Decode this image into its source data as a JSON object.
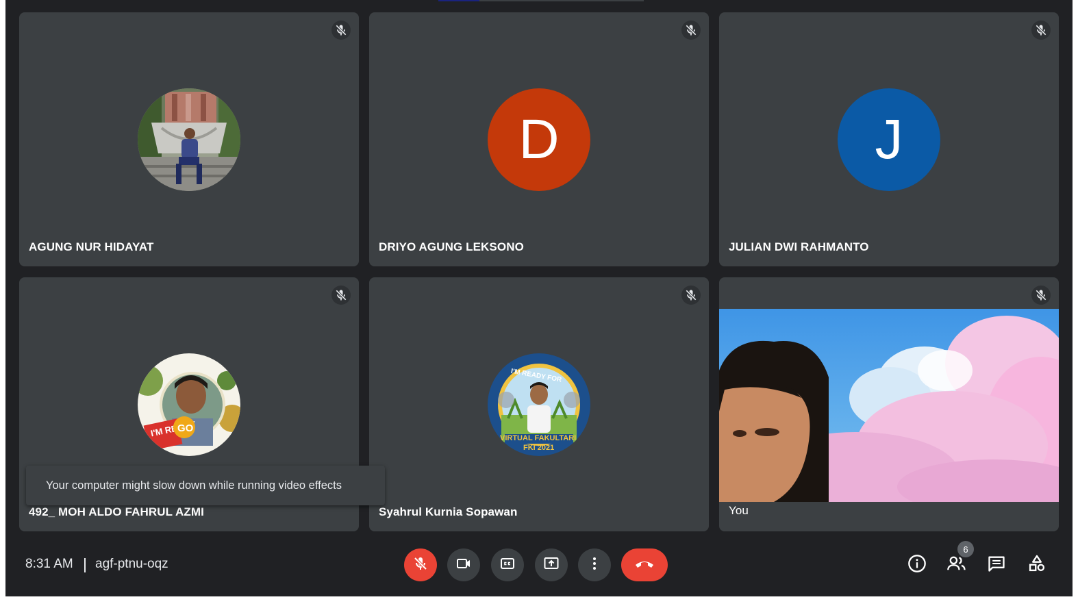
{
  "meeting": {
    "time": "8:31 AM",
    "code": "agf-ptnu-oqz"
  },
  "participants": [
    {
      "name": "AGUNG NUR HIDAYAT",
      "avatar_type": "photo",
      "muted": true
    },
    {
      "name": "DRIYO AGUNG LEKSONO",
      "avatar_type": "letter",
      "letter": "D",
      "color": "#c4390a",
      "muted": true
    },
    {
      "name": "JULIAN DWI RAHMANTO",
      "avatar_type": "letter",
      "letter": "J",
      "color": "#0b5aa6",
      "muted": true
    },
    {
      "name": "492_ MOH ALDO FAHRUL AZMI",
      "avatar_type": "photo",
      "muted": true
    },
    {
      "name": "Syahrul Kurnia Sopawan",
      "avatar_type": "photo",
      "muted": true
    },
    {
      "name": "You",
      "avatar_type": "video",
      "muted": true
    }
  ],
  "avatar_texts": {
    "aldo_badge_left": "I'M READY",
    "aldo_badge_right": "GO",
    "syahrul_top": "I'M READY FOR",
    "syahrul_bottom1": "VIRTUAL FAKULTARI",
    "syahrul_bottom2": "FKI 2021"
  },
  "toast": {
    "message": "Your computer might slow down while running video effects"
  },
  "controls": {
    "mic": "mic-off-icon",
    "camera": "video-camera-icon",
    "captions": "closed-captions-icon",
    "present": "present-screen-icon",
    "more": "more-options-icon",
    "leave": "hang-up-icon"
  },
  "side_controls": {
    "info": "info-icon",
    "people": "people-icon",
    "people_count": "6",
    "chat": "chat-icon",
    "activities": "activities-icon"
  },
  "colors": {
    "background": "#202124",
    "tile": "#3c4043",
    "danger": "#ea4335"
  }
}
